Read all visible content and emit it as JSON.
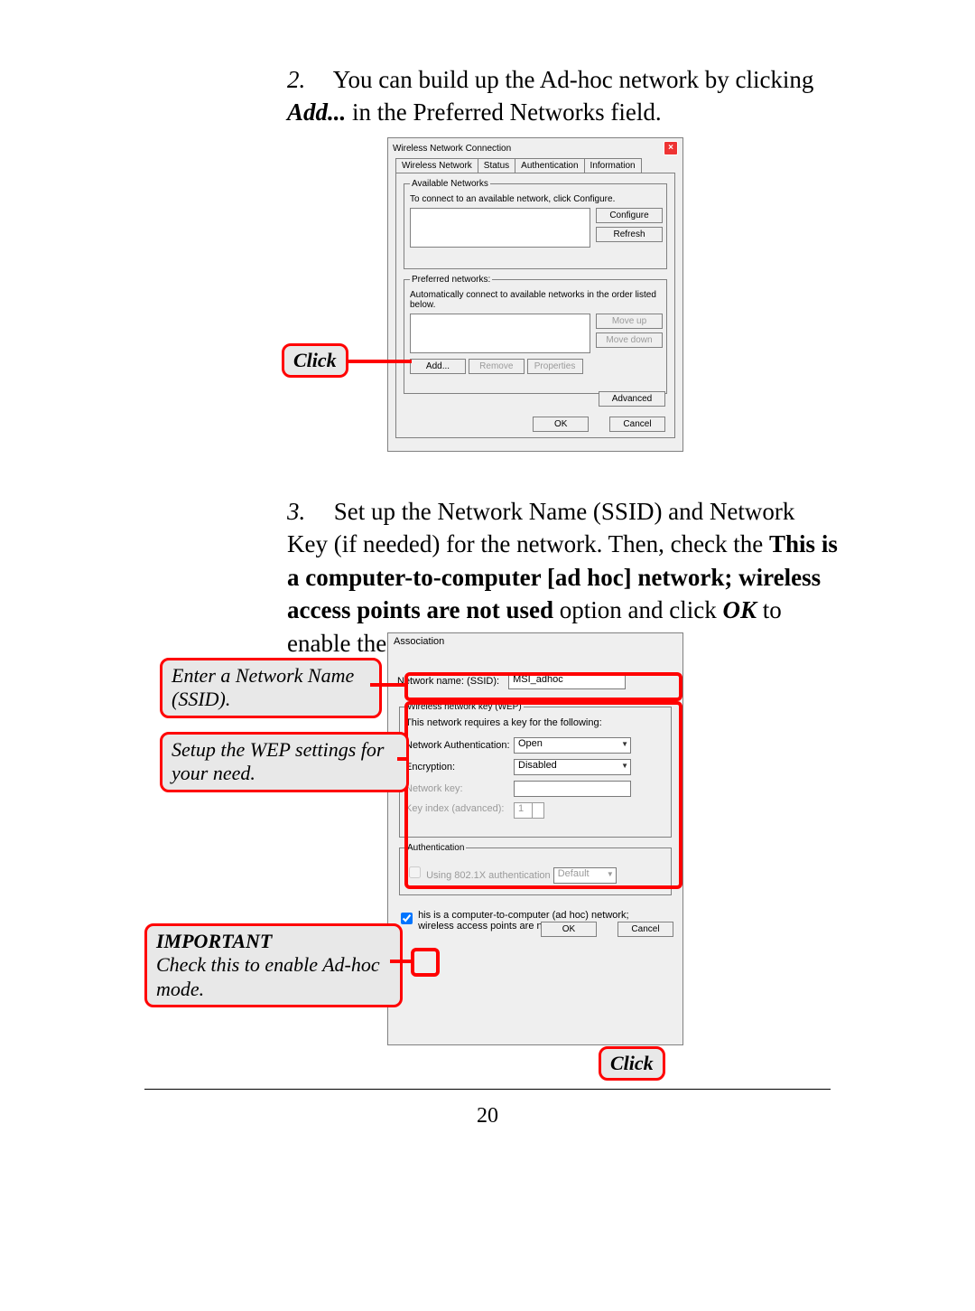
{
  "step2": {
    "num": "2.",
    "text_a": "You can build up the Ad-hoc network by clicking ",
    "text_b": "Add...",
    "text_c": " in the Preferred Networks field."
  },
  "step3": {
    "num": "3.",
    "text_a": "Set up the Network Name (SSID) and Network Key (if needed) for the network.  Then, check the ",
    "text_b": "This is a computer-to-computer [ad hoc] network; wireless access points are not used",
    "text_c": " option and click ",
    "text_d": "OK",
    "text_e": " to enable the Ad-hoc mode."
  },
  "dlg1": {
    "title": "Wireless Network Connection",
    "tabs": {
      "wireless": "Wireless Network",
      "status": "Status",
      "auth": "Authentication",
      "info": "Information"
    },
    "available_legend": "Available Networks",
    "available_help": "To connect to an available network, click Configure.",
    "configure": "Configure",
    "refresh": "Refresh",
    "preferred_legend": "Preferred networks:",
    "preferred_help": "Automatically connect to available networks in the order listed below.",
    "moveup": "Move up",
    "movedown": "Move down",
    "add": "Add...",
    "remove": "Remove",
    "properties": "Properties",
    "advanced": "Advanced",
    "ok": "OK",
    "cancel": "Cancel"
  },
  "dlg2": {
    "title": "Association",
    "ssid_label": "Network name:   (SSID):",
    "ssid_value": "MSI_adhoc",
    "wep_legend": "Wireless network key (WEP)",
    "wep_help": "This network requires a key for the following:",
    "auth_label": "Network Authentication:",
    "auth_value": "Open",
    "enc_label": "Encryption:",
    "enc_value": "Disabled",
    "key_label": "Network key:",
    "keyidx_label": "Key index (advanced):",
    "keyidx_value": "1",
    "auth8021x_legend": "Authentication",
    "auth8021x_label": "Using 802.1X authentication",
    "auth8021x_value": "Default",
    "adhoc_label_a": "his is a computer-to-computer (ad hoc) network;",
    "adhoc_label_b": "wireless access points are not used",
    "ok": "OK",
    "cancel": "Cancel"
  },
  "callouts": {
    "click": "Click",
    "ssid": "Enter a Network Name (SSID).",
    "wep": "Setup the WEP settings for your need.",
    "important": "IMPORTANT",
    "adhoc": "Check this to enable Ad-hoc mode.",
    "click2": "Click"
  },
  "pagenum": "20"
}
